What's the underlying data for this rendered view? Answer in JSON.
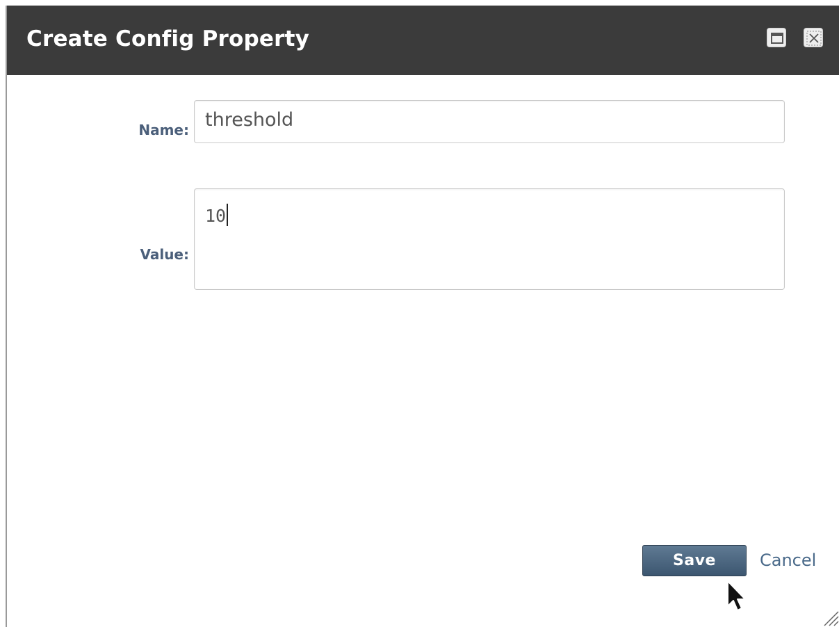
{
  "dialog": {
    "title": "Create Config Property",
    "maximize_icon": "window-maximize-icon",
    "close_icon": "close-icon"
  },
  "form": {
    "name_label": "Name:",
    "name_value": "threshold",
    "value_label": "Value:",
    "value_value": "10"
  },
  "actions": {
    "save_label": "Save",
    "cancel_label": "Cancel"
  },
  "colors": {
    "titlebar": "#3b3b3b",
    "label": "#4b5f7a",
    "save_button": "#4a6580",
    "link": "#4a6a8a"
  }
}
